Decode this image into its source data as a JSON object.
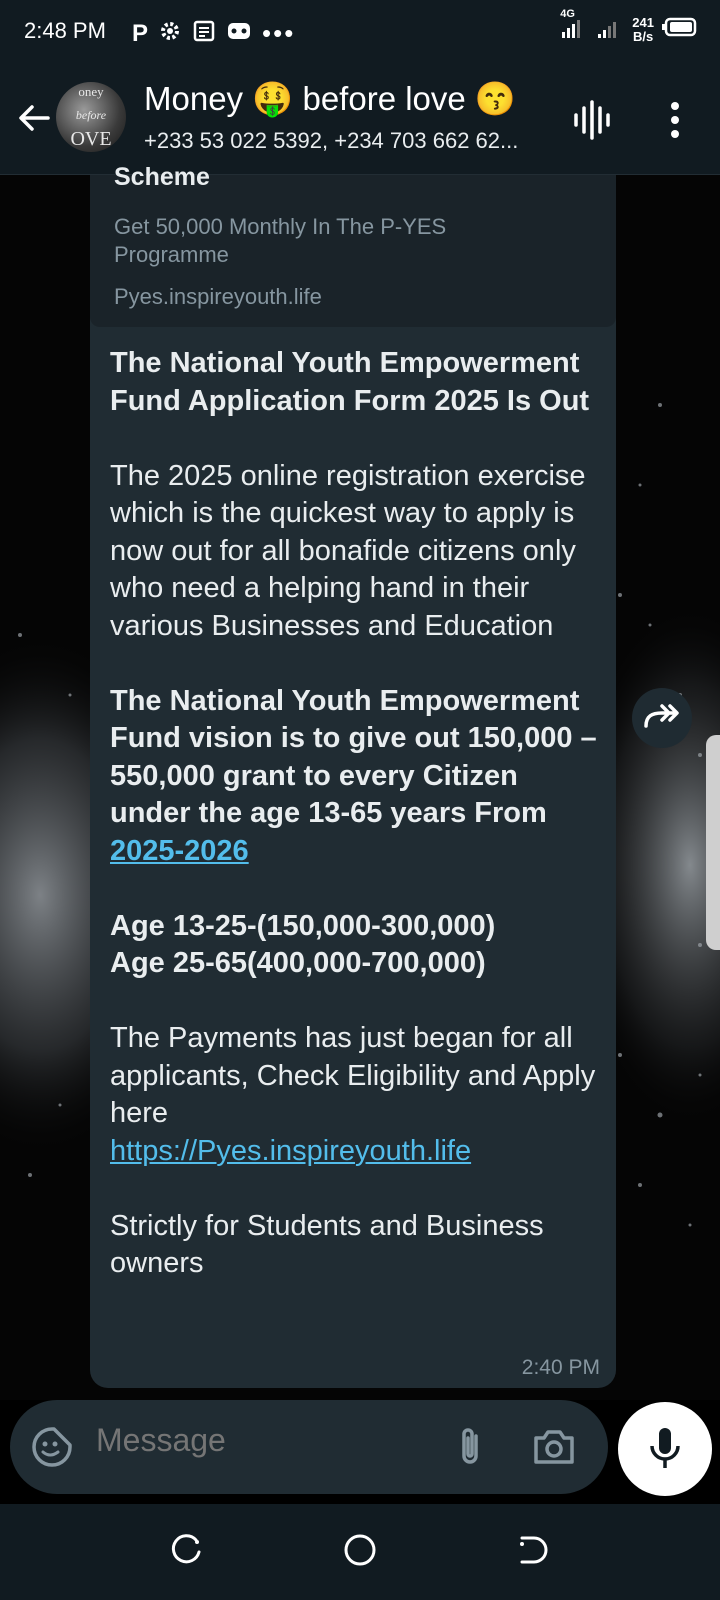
{
  "status_bar": {
    "time": "2:48 PM",
    "left_icons": [
      "parking-p-icon",
      "gear-icon",
      "news-icon",
      "game-icon",
      "more-dots-icon"
    ],
    "network_type": "4G",
    "net_speed_value": "241",
    "net_speed_unit": "B/s"
  },
  "header": {
    "title": "Money 🤑 before love 😙",
    "subtitle": "+233 53 022 5392, +234 703 662 62...",
    "avatar_text_top": "oney",
    "avatar_text_mid": "before",
    "avatar_text_bottom": "OVE"
  },
  "link_preview": {
    "title": "Scheme",
    "description": "Get 50,000 Monthly In The P-YES Programme",
    "domain": "Pyes.inspireyouth.life"
  },
  "message": {
    "heading": "The National Youth Empowerment Fund Application Form 2025 Is Out",
    "paragraph1": "The 2025 online registration exercise which is the quickest way to apply is now out for all bonafide citizens only who need a helping hand in their various Businesses and Education",
    "vision": "The National Youth Empowerment Fund vision is to give out 150,000 – 550,000 grant to every Citizen under the age 13-65 years From",
    "vision_link": "2025-2026",
    "age_line1": "Age 13-25-(150,000-300,000)",
    "age_line2": "Age 25-65(400,000-700,000)",
    "payments": "The Payments has just began for all applicants, Check Eligibility and Apply here",
    "url_link": "https://Pyes.inspireyouth.life",
    "closing": "Strictly for Students and Business owners",
    "time": "2:40 PM"
  },
  "composer": {
    "placeholder": "Message"
  },
  "colors": {
    "bubble": "#202c33",
    "header": "#111b21",
    "link": "#53bdeb",
    "muted": "#8696a0"
  }
}
